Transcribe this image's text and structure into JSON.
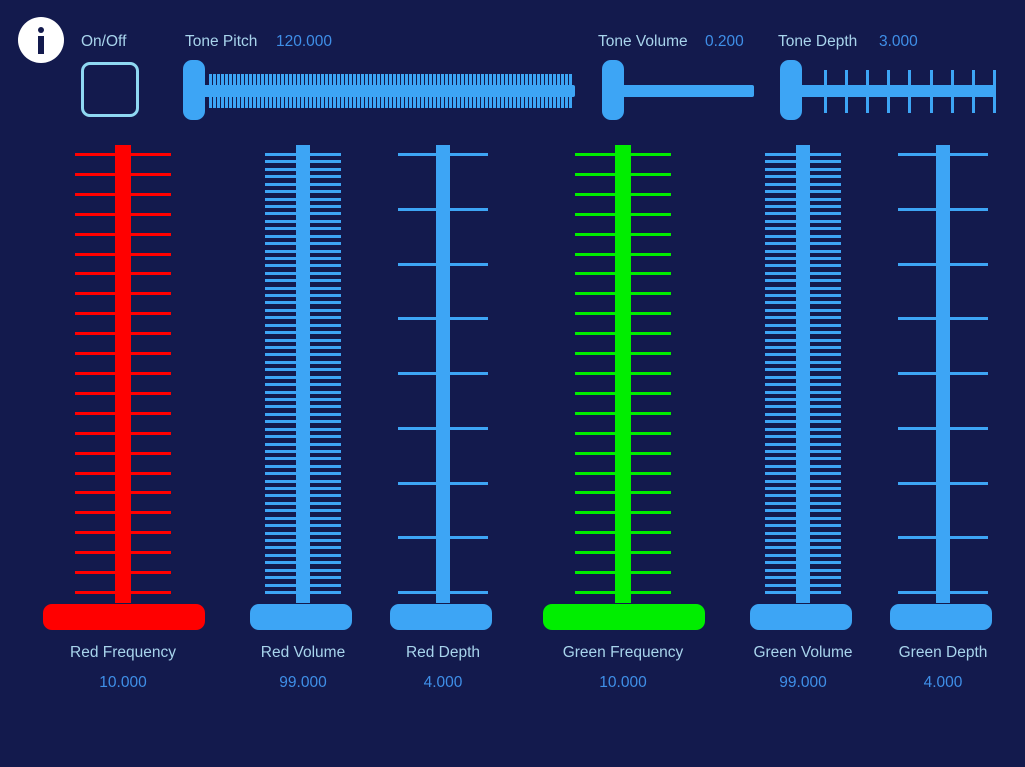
{
  "app": {
    "background_color": "#131a4d",
    "accent_blue": "#3da5f5",
    "label_color": "#a8d4ec",
    "value_color": "#3f8fe8",
    "red_color": "#ff0000",
    "green_color": "#00ee00",
    "checkbox_border_color": "#8fd8f2"
  },
  "top_controls": {
    "info_icon": "info-icon",
    "onoff": {
      "label": "On/Off",
      "checked": false
    },
    "tone_pitch": {
      "label": "Tone Pitch",
      "value": "120.000",
      "value_num": 120.0,
      "thumb_position": "min",
      "tick_count": 120,
      "tick_style": "dense"
    },
    "tone_volume": {
      "label": "Tone Volume",
      "value": "0.200",
      "value_num": 0.2,
      "thumb_position": "min",
      "tick_count": 0,
      "tick_style": "none"
    },
    "tone_depth": {
      "label": "Tone Depth",
      "value": "3.000",
      "value_num": 3.0,
      "thumb_position": "min",
      "tick_count": 9,
      "tick_style": "sparse"
    }
  },
  "vertical_sliders": [
    {
      "name": "red-frequency",
      "label": "Red Frequency",
      "value": "10.000",
      "value_num": 10.0,
      "color": "#ff0000",
      "tick_count": 23,
      "tick_style": "medium",
      "thumb_width": "wide",
      "thumb_position": "bottom"
    },
    {
      "name": "red-volume",
      "label": "Red Volume",
      "value": "99.000",
      "value_num": 99.0,
      "color": "#3da5f5",
      "tick_count": 60,
      "tick_style": "dense",
      "thumb_width": "narrow",
      "thumb_position": "bottom"
    },
    {
      "name": "red-depth",
      "label": "Red Depth",
      "value": "4.000",
      "value_num": 4.0,
      "color": "#3da5f5",
      "tick_count": 9,
      "tick_style": "sparse",
      "thumb_width": "narrow",
      "thumb_position": "bottom"
    },
    {
      "name": "green-frequency",
      "label": "Green Frequency",
      "value": "10.000",
      "value_num": 10.0,
      "color": "#00ee00",
      "tick_count": 23,
      "tick_style": "medium",
      "thumb_width": "wide",
      "thumb_position": "bottom"
    },
    {
      "name": "green-volume",
      "label": "Green Volume",
      "value": "99.000",
      "value_num": 99.0,
      "color": "#3da5f5",
      "tick_count": 60,
      "tick_style": "dense",
      "thumb_width": "narrow",
      "thumb_position": "bottom"
    },
    {
      "name": "green-depth",
      "label": "Green Depth",
      "value": "4.000",
      "value_num": 4.0,
      "color": "#3da5f5",
      "tick_count": 9,
      "tick_style": "sparse",
      "thumb_width": "narrow",
      "thumb_position": "bottom"
    }
  ]
}
